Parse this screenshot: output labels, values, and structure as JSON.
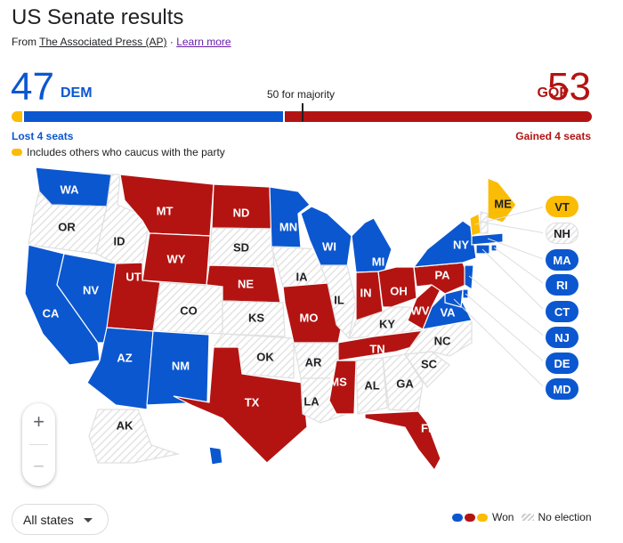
{
  "header": {
    "title": "US Senate results",
    "source_prefix": "From",
    "source_link": "The Associated Press (AP)",
    "separator": "·",
    "learn_more": "Learn more"
  },
  "tally": {
    "dem": {
      "count": "47",
      "label": "DEM",
      "change": "Lost 4 seats",
      "color": "#0b57d0"
    },
    "gop": {
      "count": "53",
      "label": "GOP",
      "change": "Gained 4 seats",
      "color": "#b31412"
    },
    "majority_label": "50 for majority",
    "independent_note": "Includes others who caucus with the party",
    "independent_color": "#fbbc05",
    "seats": {
      "independent": 2,
      "dem": 45,
      "gop": 53,
      "total": 100,
      "majority": 50
    }
  },
  "map": {
    "colors": {
      "dem": "#0b57d0",
      "gop": "#b31412",
      "ind": "#fbbc05",
      "none": "hatched"
    },
    "states": [
      {
        "abbr": "WA",
        "result": "dem"
      },
      {
        "abbr": "OR",
        "result": "none"
      },
      {
        "abbr": "CA",
        "result": "dem"
      },
      {
        "abbr": "NV",
        "result": "dem"
      },
      {
        "abbr": "ID",
        "result": "none"
      },
      {
        "abbr": "MT",
        "result": "gop"
      },
      {
        "abbr": "WY",
        "result": "gop"
      },
      {
        "abbr": "UT",
        "result": "gop"
      },
      {
        "abbr": "AZ",
        "result": "dem"
      },
      {
        "abbr": "CO",
        "result": "none"
      },
      {
        "abbr": "NM",
        "result": "dem"
      },
      {
        "abbr": "ND",
        "result": "gop"
      },
      {
        "abbr": "SD",
        "result": "none"
      },
      {
        "abbr": "NE",
        "result": "gop"
      },
      {
        "abbr": "KS",
        "result": "none"
      },
      {
        "abbr": "OK",
        "result": "none"
      },
      {
        "abbr": "TX",
        "result": "gop"
      },
      {
        "abbr": "MN",
        "result": "dem"
      },
      {
        "abbr": "IA",
        "result": "none"
      },
      {
        "abbr": "MO",
        "result": "gop"
      },
      {
        "abbr": "AR",
        "result": "none"
      },
      {
        "abbr": "LA",
        "result": "none"
      },
      {
        "abbr": "WI",
        "result": "dem"
      },
      {
        "abbr": "IL",
        "result": "none"
      },
      {
        "abbr": "MI",
        "result": "dem"
      },
      {
        "abbr": "IN",
        "result": "gop"
      },
      {
        "abbr": "OH",
        "result": "gop"
      },
      {
        "abbr": "KY",
        "result": "none"
      },
      {
        "abbr": "TN",
        "result": "gop"
      },
      {
        "abbr": "MS",
        "result": "gop"
      },
      {
        "abbr": "AL",
        "result": "none"
      },
      {
        "abbr": "GA",
        "result": "none"
      },
      {
        "abbr": "FL",
        "result": "gop"
      },
      {
        "abbr": "SC",
        "result": "none"
      },
      {
        "abbr": "NC",
        "result": "none"
      },
      {
        "abbr": "VA",
        "result": "dem"
      },
      {
        "abbr": "WV",
        "result": "gop"
      },
      {
        "abbr": "PA",
        "result": "gop"
      },
      {
        "abbr": "NY",
        "result": "dem"
      },
      {
        "abbr": "ME",
        "result": "ind"
      },
      {
        "abbr": "AK",
        "result": "none"
      },
      {
        "abbr": "HI",
        "result": "dem"
      }
    ],
    "callouts": [
      {
        "abbr": "VT",
        "result": "ind"
      },
      {
        "abbr": "NH",
        "result": "none"
      },
      {
        "abbr": "MA",
        "result": "dem"
      },
      {
        "abbr": "RI",
        "result": "dem"
      },
      {
        "abbr": "CT",
        "result": "dem"
      },
      {
        "abbr": "NJ",
        "result": "dem"
      },
      {
        "abbr": "DE",
        "result": "dem"
      },
      {
        "abbr": "MD",
        "result": "dem"
      }
    ]
  },
  "controls": {
    "zoom_in": "+",
    "zoom_out": "−",
    "filter_value": "All states"
  },
  "legend": {
    "won_label": "Won",
    "no_election_label": "No election"
  }
}
